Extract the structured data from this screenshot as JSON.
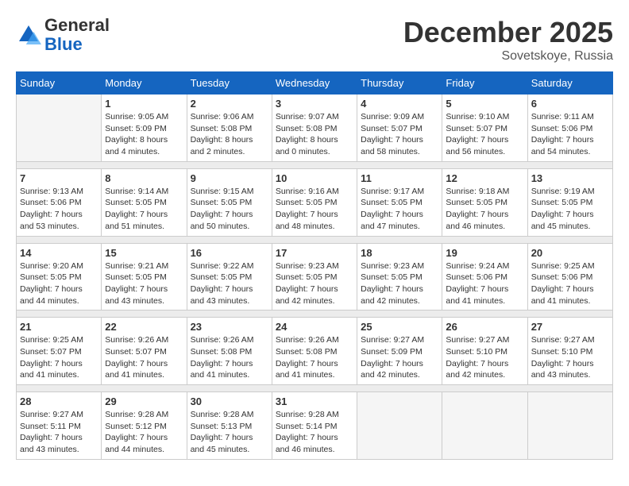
{
  "logo": {
    "general": "General",
    "blue": "Blue"
  },
  "title": "December 2025",
  "location": "Sovetskoye, Russia",
  "days_of_week": [
    "Sunday",
    "Monday",
    "Tuesday",
    "Wednesday",
    "Thursday",
    "Friday",
    "Saturday"
  ],
  "weeks": [
    [
      {
        "day": "",
        "info": ""
      },
      {
        "day": "1",
        "info": "Sunrise: 9:05 AM\nSunset: 5:09 PM\nDaylight: 8 hours\nand 4 minutes."
      },
      {
        "day": "2",
        "info": "Sunrise: 9:06 AM\nSunset: 5:08 PM\nDaylight: 8 hours\nand 2 minutes."
      },
      {
        "day": "3",
        "info": "Sunrise: 9:07 AM\nSunset: 5:08 PM\nDaylight: 8 hours\nand 0 minutes."
      },
      {
        "day": "4",
        "info": "Sunrise: 9:09 AM\nSunset: 5:07 PM\nDaylight: 7 hours\nand 58 minutes."
      },
      {
        "day": "5",
        "info": "Sunrise: 9:10 AM\nSunset: 5:07 PM\nDaylight: 7 hours\nand 56 minutes."
      },
      {
        "day": "6",
        "info": "Sunrise: 9:11 AM\nSunset: 5:06 PM\nDaylight: 7 hours\nand 54 minutes."
      }
    ],
    [
      {
        "day": "7",
        "info": "Sunrise: 9:13 AM\nSunset: 5:06 PM\nDaylight: 7 hours\nand 53 minutes."
      },
      {
        "day": "8",
        "info": "Sunrise: 9:14 AM\nSunset: 5:05 PM\nDaylight: 7 hours\nand 51 minutes."
      },
      {
        "day": "9",
        "info": "Sunrise: 9:15 AM\nSunset: 5:05 PM\nDaylight: 7 hours\nand 50 minutes."
      },
      {
        "day": "10",
        "info": "Sunrise: 9:16 AM\nSunset: 5:05 PM\nDaylight: 7 hours\nand 48 minutes."
      },
      {
        "day": "11",
        "info": "Sunrise: 9:17 AM\nSunset: 5:05 PM\nDaylight: 7 hours\nand 47 minutes."
      },
      {
        "day": "12",
        "info": "Sunrise: 9:18 AM\nSunset: 5:05 PM\nDaylight: 7 hours\nand 46 minutes."
      },
      {
        "day": "13",
        "info": "Sunrise: 9:19 AM\nSunset: 5:05 PM\nDaylight: 7 hours\nand 45 minutes."
      }
    ],
    [
      {
        "day": "14",
        "info": "Sunrise: 9:20 AM\nSunset: 5:05 PM\nDaylight: 7 hours\nand 44 minutes."
      },
      {
        "day": "15",
        "info": "Sunrise: 9:21 AM\nSunset: 5:05 PM\nDaylight: 7 hours\nand 43 minutes."
      },
      {
        "day": "16",
        "info": "Sunrise: 9:22 AM\nSunset: 5:05 PM\nDaylight: 7 hours\nand 43 minutes."
      },
      {
        "day": "17",
        "info": "Sunrise: 9:23 AM\nSunset: 5:05 PM\nDaylight: 7 hours\nand 42 minutes."
      },
      {
        "day": "18",
        "info": "Sunrise: 9:23 AM\nSunset: 5:05 PM\nDaylight: 7 hours\nand 42 minutes."
      },
      {
        "day": "19",
        "info": "Sunrise: 9:24 AM\nSunset: 5:06 PM\nDaylight: 7 hours\nand 41 minutes."
      },
      {
        "day": "20",
        "info": "Sunrise: 9:25 AM\nSunset: 5:06 PM\nDaylight: 7 hours\nand 41 minutes."
      }
    ],
    [
      {
        "day": "21",
        "info": "Sunrise: 9:25 AM\nSunset: 5:07 PM\nDaylight: 7 hours\nand 41 minutes."
      },
      {
        "day": "22",
        "info": "Sunrise: 9:26 AM\nSunset: 5:07 PM\nDaylight: 7 hours\nand 41 minutes."
      },
      {
        "day": "23",
        "info": "Sunrise: 9:26 AM\nSunset: 5:08 PM\nDaylight: 7 hours\nand 41 minutes."
      },
      {
        "day": "24",
        "info": "Sunrise: 9:26 AM\nSunset: 5:08 PM\nDaylight: 7 hours\nand 41 minutes."
      },
      {
        "day": "25",
        "info": "Sunrise: 9:27 AM\nSunset: 5:09 PM\nDaylight: 7 hours\nand 42 minutes."
      },
      {
        "day": "26",
        "info": "Sunrise: 9:27 AM\nSunset: 5:10 PM\nDaylight: 7 hours\nand 42 minutes."
      },
      {
        "day": "27",
        "info": "Sunrise: 9:27 AM\nSunset: 5:10 PM\nDaylight: 7 hours\nand 43 minutes."
      }
    ],
    [
      {
        "day": "28",
        "info": "Sunrise: 9:27 AM\nSunset: 5:11 PM\nDaylight: 7 hours\nand 43 minutes."
      },
      {
        "day": "29",
        "info": "Sunrise: 9:28 AM\nSunset: 5:12 PM\nDaylight: 7 hours\nand 44 minutes."
      },
      {
        "day": "30",
        "info": "Sunrise: 9:28 AM\nSunset: 5:13 PM\nDaylight: 7 hours\nand 45 minutes."
      },
      {
        "day": "31",
        "info": "Sunrise: 9:28 AM\nSunset: 5:14 PM\nDaylight: 7 hours\nand 46 minutes."
      },
      {
        "day": "",
        "info": ""
      },
      {
        "day": "",
        "info": ""
      },
      {
        "day": "",
        "info": ""
      }
    ]
  ]
}
